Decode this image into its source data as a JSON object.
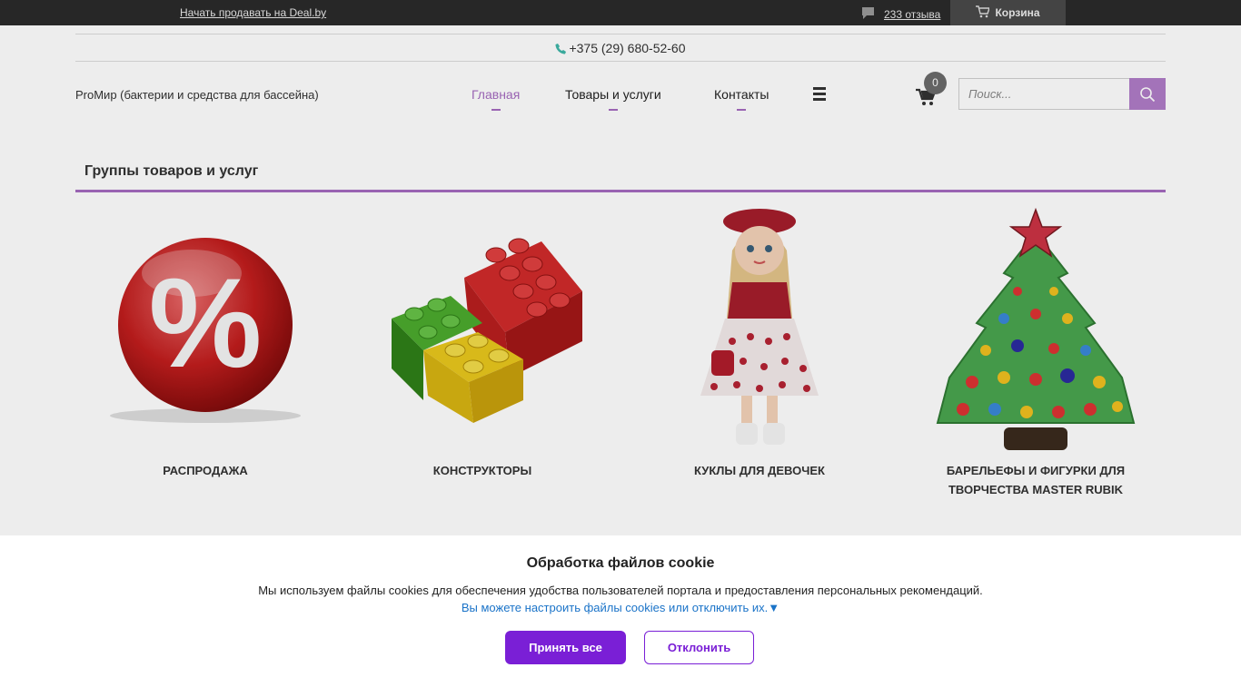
{
  "topbar": {
    "sell_link": "Начать продавать на Deal.by",
    "reviews": "233 отзыва",
    "cart": "Корзина"
  },
  "header": {
    "phone": "+375 (29) 680-52-60",
    "company": "ProМир (бактерии и средства для бассейна)",
    "nav": {
      "home": "Главная",
      "goods": "Товары и услуги",
      "contacts": "Контакты"
    },
    "cart_count": "0",
    "search_placeholder": "Поиск..."
  },
  "section": {
    "title": "Группы товаров и услуг",
    "cards": [
      {
        "label": "РАСПРОДАЖА",
        "icon": "sale-percent-ball-image"
      },
      {
        "label": "КОНСТРУКТОРЫ",
        "icon": "lego-bricks-image"
      },
      {
        "label": "КУКЛЫ ДЛЯ ДЕВОЧЕК",
        "icon": "doll-image"
      },
      {
        "label": "БАРЕЛЬЕФЫ И ФИГУРКИ ДЛЯ ТВОРЧЕСТВА MASTER RUBIK",
        "icon": "christmas-tree-image"
      }
    ]
  },
  "cookie": {
    "title": "Обработка файлов cookie",
    "text": "Мы используем файлы cookies для обеспечения удобства пользователей портала и предоставления персональных рекомендаций.",
    "settings_link": "Вы можете настроить файлы cookies или отключить их.▼",
    "accept": "Принять все",
    "decline": "Отклонить"
  },
  "colors": {
    "accent": "#a56bc0",
    "cookie_button": "#7a1fd6",
    "topbar": "#2b2b2b"
  }
}
